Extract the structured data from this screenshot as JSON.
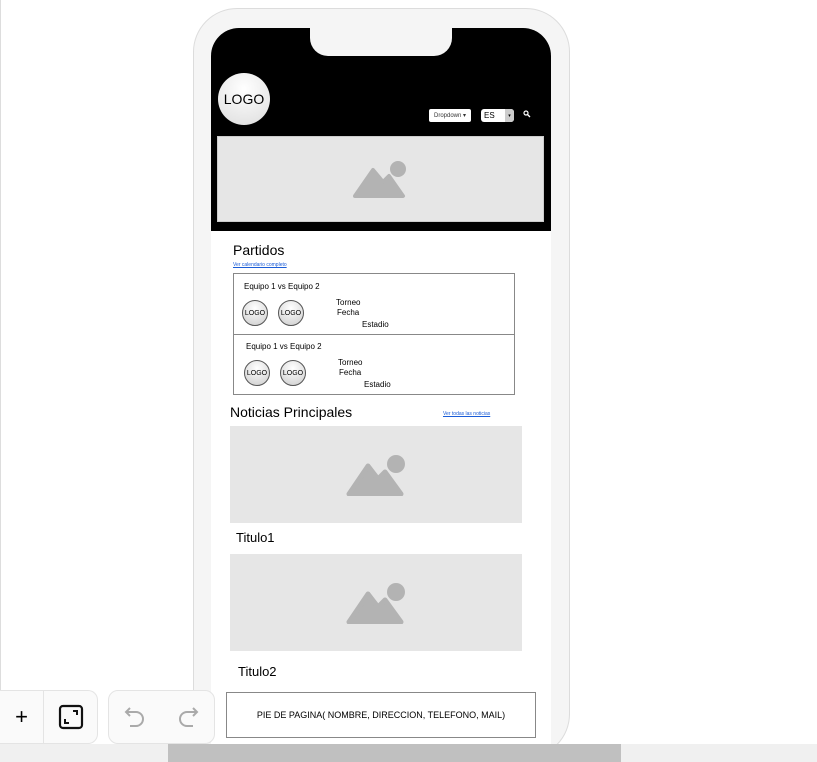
{
  "header": {
    "logo": "LOGO",
    "dropdown": "Dropdown ▾",
    "language": "ES",
    "language_caret": "▾",
    "search_icon": "search-icon"
  },
  "partidos": {
    "title": "Partidos",
    "link": "Ver calendario completo",
    "matches": [
      {
        "teams": "Equipo 1 vs Equipo 2",
        "logo1": "LOGO",
        "logo2": "LOGO",
        "torneo": "Torneo",
        "fecha": "Fecha",
        "estadio": "Estadio"
      },
      {
        "teams": "Equipo 1 vs Equipo 2",
        "logo1": "LOGO",
        "logo2": "LOGO",
        "torneo": "Torneo",
        "fecha": "Fecha",
        "estadio": "Estadio"
      }
    ]
  },
  "noticias": {
    "title": "Noticias Principales",
    "link": "Ver todas las noticias",
    "items": [
      {
        "title": "Titulo1"
      },
      {
        "title": "Titulo2"
      }
    ]
  },
  "footer": {
    "text": "PIE DE PAGINA( NOMBRE, DIRECCION, TELEFONO, MAIL)"
  },
  "toolbar": {
    "zoom_in": "+",
    "icons": [
      "plus-icon",
      "fit-screen-icon",
      "undo-icon",
      "redo-icon"
    ]
  }
}
